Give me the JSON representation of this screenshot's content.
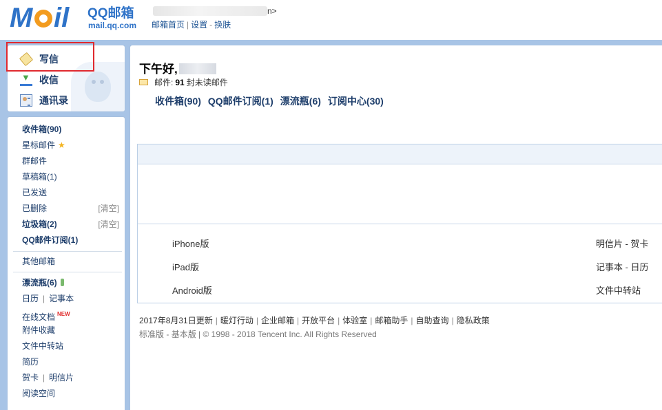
{
  "header": {
    "logo_text_m": "M",
    "logo_text_il": "il",
    "logo_brand": "QQ邮箱",
    "logo_url": "mail.qq.com",
    "account_suffix": "n>",
    "links": [
      "邮箱首页",
      "设置",
      "换肤"
    ]
  },
  "sidebar": {
    "actions": [
      {
        "label": "写信",
        "icon": "pen-icon"
      },
      {
        "label": "收信",
        "icon": "inbox-icon"
      },
      {
        "label": "通讯录",
        "icon": "contacts-icon"
      }
    ],
    "folders": {
      "inbox": "收件箱(90)",
      "starred": "星标邮件",
      "group": "群邮件",
      "drafts": "草稿箱(1)",
      "sent": "已发送",
      "deleted": "已删除",
      "spam": "垃圾箱(2)",
      "subscription": "QQ邮件订阅(1)",
      "clear_label": "[清空]"
    },
    "other_mailbox": "其他邮箱",
    "apps": {
      "drift_bottle": "漂流瓶(6)",
      "calendar": "日历",
      "notes": "记事本",
      "online_docs": "在线文档",
      "new_tag": "NEW",
      "attachments": "附件收藏",
      "file_transfer": "文件中转站",
      "resume": "简历",
      "greeting_card": "贺卡",
      "postcard": "明信片",
      "reading_space": "阅读空间"
    }
  },
  "main": {
    "greeting": "下午好,",
    "mail_label": "邮件:",
    "unread_count": "91",
    "unread_suffix": "封未读邮件",
    "quicklinks": [
      "收件箱(90)",
      "QQ邮件订阅(1)",
      "漂流瓶(6)",
      "订阅中心(30)"
    ],
    "downloads_left": [
      "iPhone版",
      "iPad版",
      "Android版"
    ],
    "downloads_right": [
      "明信片 - 贺卡",
      "记事本 - 日历",
      "文件中转站"
    ]
  },
  "footer": {
    "links": [
      "2017年8月31日更新",
      "暖灯行动",
      "企业邮箱",
      "开放平台",
      "体验室",
      "邮箱助手",
      "自助查询",
      "隐私政策"
    ],
    "version_standard": "标准版",
    "version_basic": "基本版",
    "copyright": "© 1998 - 2018 Tencent Inc. All Rights Reserved"
  }
}
